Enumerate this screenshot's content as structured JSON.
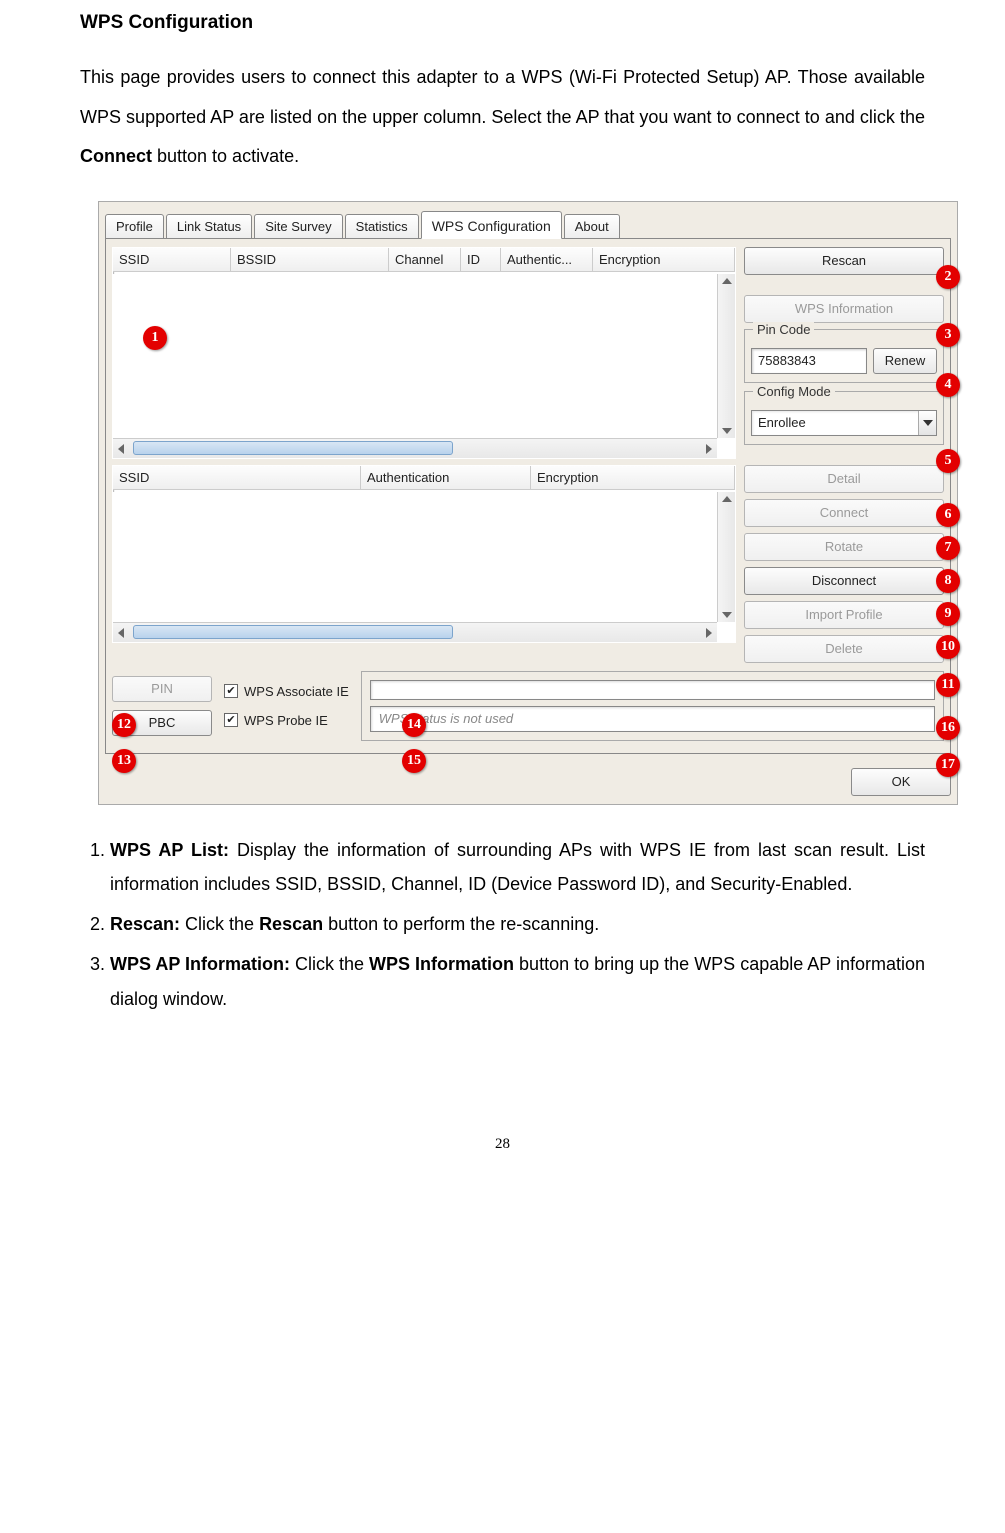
{
  "section_title": "WPS Configuration",
  "intro_part1": "This page provides users to connect this adapter to a WPS (Wi-Fi Protected Setup) AP. Those available WPS supported AP are listed on the upper column. Select the AP that you want to connect to and click the ",
  "intro_bold": "Connect",
  "intro_part2": " button to activate.",
  "tabs": {
    "profile": "Profile",
    "link_status": "Link Status",
    "site_survey": "Site Survey",
    "statistics": "Statistics",
    "wps": "WPS Configuration",
    "about": "About"
  },
  "ap_list_headers": {
    "ssid": "SSID",
    "bssid": "BSSID",
    "channel": "Channel",
    "id": "ID",
    "auth": "Authentic...",
    "enc": "Encryption"
  },
  "profile_list_headers": {
    "ssid": "SSID",
    "auth": "Authentication",
    "enc": "Encryption"
  },
  "buttons": {
    "rescan": "Rescan",
    "wps_info": "WPS Information",
    "renew": "Renew",
    "detail": "Detail",
    "connect": "Connect",
    "rotate": "Rotate",
    "disconnect": "Disconnect",
    "import_profile": "Import Profile",
    "delete": "Delete",
    "pin": "PIN",
    "pbc": "PBC",
    "ok": "OK"
  },
  "pin_group": {
    "label": "Pin Code",
    "value": "75883843"
  },
  "config_mode": {
    "label": "Config Mode",
    "value": "Enrollee"
  },
  "checkboxes": {
    "assoc": "WPS Associate IE",
    "probe": "WPS Probe IE"
  },
  "status_placeholder": "WPS status is not used",
  "callouts": {
    "c1": "1",
    "c2": "2",
    "c3": "3",
    "c4": "4",
    "c5": "5",
    "c6": "6",
    "c7": "7",
    "c8": "8",
    "c9": "9",
    "c10": "10",
    "c11": "11",
    "c12": "12",
    "c13": "13",
    "c14": "14",
    "c15": "15",
    "c16": "16",
    "c17": "17"
  },
  "notes": {
    "n1_label": "WPS AP List:",
    "n1_text": " Display the information of surrounding APs with WPS IE from last scan result. List information includes SSID, BSSID, Channel, ID (Device Password ID), and Security-Enabled.",
    "n2_label": "Rescan:",
    "n2_text1": " Click the ",
    "n2_bold": "Rescan",
    "n2_text2": " button to perform the re-scanning.",
    "n3_label": "WPS AP Information:",
    "n3_text1": " Click the ",
    "n3_bold": "WPS Information",
    "n3_text2": " button to bring up the WPS capable AP information dialog window."
  },
  "page_number": "28"
}
